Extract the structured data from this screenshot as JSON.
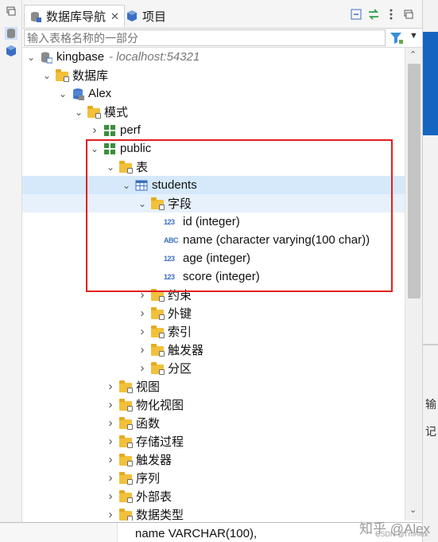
{
  "tabs": [
    {
      "label": "数据库导航",
      "active": true,
      "closable": true
    },
    {
      "label": "项目",
      "active": false,
      "closable": false
    }
  ],
  "filter": {
    "placeholder": "输入表格名称的一部分"
  },
  "tree": [
    {
      "label": "kingbase",
      "sub": "- localhost:54321",
      "depth": 0,
      "icon": "database-connection-icon",
      "expanded": true
    },
    {
      "label": "数据库",
      "depth": 1,
      "icon": "folder-icon",
      "expanded": true
    },
    {
      "label": "Alex",
      "depth": 2,
      "icon": "database-icon",
      "expanded": true
    },
    {
      "label": "模式",
      "depth": 3,
      "icon": "folder-icon",
      "expanded": true
    },
    {
      "label": "perf",
      "depth": 4,
      "icon": "schema-icon",
      "expanded": false
    },
    {
      "label": "public",
      "depth": 4,
      "icon": "schema-icon",
      "expanded": true
    },
    {
      "label": "表",
      "depth": 5,
      "icon": "folder-icon",
      "expanded": true
    },
    {
      "label": "students",
      "depth": 6,
      "icon": "table-icon",
      "expanded": true,
      "selected": true
    },
    {
      "label": "字段",
      "depth": 7,
      "icon": "folder-icon",
      "expanded": true,
      "highlight": true
    },
    {
      "label": "id (integer)",
      "depth": 8,
      "type": "123",
      "leaf": true
    },
    {
      "label": "name (character varying(100 char))",
      "depth": 8,
      "type": "ABC",
      "leaf": true
    },
    {
      "label": "age (integer)",
      "depth": 8,
      "type": "123",
      "leaf": true
    },
    {
      "label": "score (integer)",
      "depth": 8,
      "type": "123",
      "leaf": true
    },
    {
      "label": "约束",
      "depth": 7,
      "icon": "folder-icon",
      "expanded": false
    },
    {
      "label": "外键",
      "depth": 7,
      "icon": "folder-icon",
      "expanded": false
    },
    {
      "label": "索引",
      "depth": 7,
      "icon": "folder-icon",
      "expanded": false
    },
    {
      "label": "触发器",
      "depth": 7,
      "icon": "folder-icon",
      "expanded": false
    },
    {
      "label": "分区",
      "depth": 7,
      "icon": "folder-icon",
      "expanded": false
    },
    {
      "label": "视图",
      "depth": 5,
      "icon": "folder-icon",
      "expanded": false
    },
    {
      "label": "物化视图",
      "depth": 5,
      "icon": "folder-icon",
      "expanded": false
    },
    {
      "label": "函数",
      "depth": 5,
      "icon": "folder-icon",
      "expanded": false
    },
    {
      "label": "存储过程",
      "depth": 5,
      "icon": "folder-icon",
      "expanded": false
    },
    {
      "label": "触发器",
      "depth": 5,
      "icon": "folder-icon",
      "expanded": false
    },
    {
      "label": "序列",
      "depth": 5,
      "icon": "folder-icon",
      "expanded": false
    },
    {
      "label": "外部表",
      "depth": 5,
      "icon": "folder-icon",
      "expanded": false
    },
    {
      "label": "数据类型",
      "depth": 5,
      "icon": "folder-icon",
      "expanded": false
    }
  ],
  "editor": {
    "code_line": "name VARCHAR(100),"
  },
  "right_panel": {
    "text_a": "输",
    "text_b": "记"
  },
  "watermark": {
    "main": "知乎 @Alex",
    "sub": "CSDN @I'mAlex"
  },
  "colors": {
    "selection": "#d5e9fb",
    "folder": "#f2c03a",
    "highlight_box": "#e02020",
    "schema": "#3a8f3a",
    "table": "#3b6ec2"
  }
}
